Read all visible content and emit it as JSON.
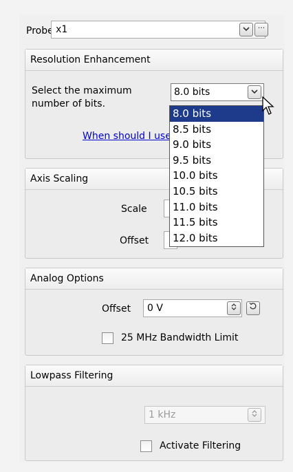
{
  "probe": {
    "label": "Probe",
    "value": "x1"
  },
  "resolution": {
    "header": "Resolution Enhancement",
    "description_line1": "Select the maximum",
    "description_line2": "number of bits.",
    "selected": "8.0 bits",
    "help_link": "When should I use this?",
    "options": [
      "8.0 bits",
      "8.5 bits",
      "9.0 bits",
      "9.5 bits",
      "10.0 bits",
      "10.5 bits",
      "11.0 bits",
      "11.5 bits",
      "12.0 bits"
    ]
  },
  "axis_scaling": {
    "header": "Axis Scaling",
    "scale_label": "Scale",
    "offset_label": "Offset"
  },
  "analog_options": {
    "header": "Analog Options",
    "offset_label": "Offset",
    "offset_value": "0 V",
    "bandwidth_label": "25 MHz Bandwidth Limit"
  },
  "lowpass": {
    "header": "Lowpass Filtering",
    "frequency_value": "1 kHz",
    "activate_label": "Activate Filtering"
  },
  "icons": {
    "chevron": "chevron-down-icon",
    "ellipsis": "ellipsis-icon",
    "spinner": "spinner-icon",
    "reset": "reset-icon",
    "cursor": "mouse-cursor-icon"
  }
}
